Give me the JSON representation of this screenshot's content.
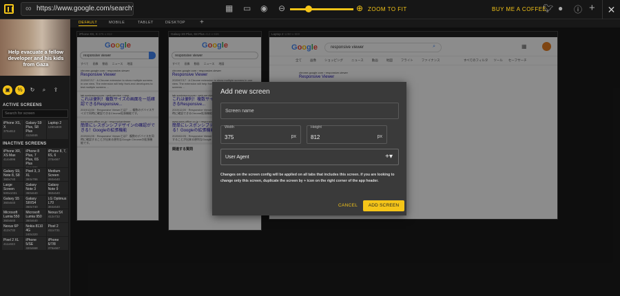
{
  "header": {
    "url": "https://www.google.com/search?q=",
    "zoom_label": "ZOOM TO FIT",
    "coffee_label": "BUY ME A COFFEE",
    "zoom_level": 0.38
  },
  "sidebar": {
    "banner_text": "Help evacuate a fellow developer and his kids from Gaza",
    "active_title": "ACTIVE SCREENS",
    "search_placeholder": "Search for screen",
    "inactive_title": "INACTIVE SCREENS",
    "active": [
      {
        "name": "iPhone XS, X",
        "dim": "375x812"
      },
      {
        "name": "Galaxy S9 Plus, S8 Plus",
        "dim": "412x846"
      },
      {
        "name": "Laptop 2",
        "dim": "1280x800"
      }
    ],
    "inactive": [
      {
        "name": "iPhone XR, XS Max",
        "dim": "414x896"
      },
      {
        "name": "iPhone 8 Plus, 7 Plus, 6S Plus",
        "dim": "414x736"
      },
      {
        "name": "iPhone 8, 7, 6S, 6",
        "dim": "375x667"
      },
      {
        "name": "Galaxy S9, Note 8, S8",
        "dim": "360x740"
      },
      {
        "name": "Pixel 3, 3 XL",
        "dim": "393x786"
      },
      {
        "name": "Medium Screen",
        "dim": "360x640"
      },
      {
        "name": "Large Screen",
        "dim": "500x1031"
      },
      {
        "name": "Galaxy Note 3",
        "dim": "360x640"
      },
      {
        "name": "Galaxy Note 9",
        "dim": "360x640"
      },
      {
        "name": "Galaxy S5",
        "dim": "360x640"
      },
      {
        "name": "Galaxy SIII/S4",
        "dim": "360x740"
      },
      {
        "name": "LG Optimus L70",
        "dim": "384x640"
      },
      {
        "name": "Microsoft Lumia 550",
        "dim": "360x640"
      },
      {
        "name": "Microsoft Lumia 950",
        "dim": "360x640"
      },
      {
        "name": "Nexus 5X",
        "dim": "412x732"
      },
      {
        "name": "Nexus 6P",
        "dim": "412x732"
      },
      {
        "name": "Nokia 8110 4G",
        "dim": "240x320"
      },
      {
        "name": "Pixel 2",
        "dim": "411x731"
      },
      {
        "name": "Pixel 2 XL",
        "dim": "411x823"
      },
      {
        "name": "iPhone 5/SE",
        "dim": "320x568"
      },
      {
        "name": "iPhone 6/7/8",
        "dim": "375x667"
      }
    ]
  },
  "device_tabs": [
    "DEFAULT",
    "MOBILE",
    "TABLET",
    "DESKTOP"
  ],
  "frames": [
    {
      "title": "iPhone XS, X",
      "dim": "375 x 812"
    },
    {
      "title": "Galaxy S9 Plus, S8 Plus",
      "dim": "412 x 846"
    },
    {
      "title": "Laptop 2",
      "dim": "1280 x 800"
    }
  ],
  "google": {
    "query": "responsive viewer",
    "nav": [
      "すべて",
      "画像",
      "動画",
      "ニュース",
      "地図"
    ],
    "r1_url": "chrome.google.com › responsive-viewer",
    "r1_title": "Responsive Viewer",
    "r1_snip": "2020/07/17 · A Chrome extension to show multiple screens in one view. The extension will help front-end developers to test multiple screens ...",
    "r2_url": "lab.sonicmoov.com › web-service › resp...",
    "r2_title": "これは便利！複数サイズの画面を一括確認できるResponsive...",
    "r2_snip": "2019/12/20 · Responsive Viewerとは？ ... 複数のデバイスサイズで同時に確認できるChrome拡張機能です。",
    "r3_url": "www.aura-office.co.jp › responsiveviewer",
    "r3_title": "簡単にレスポンシブデザインの確認ができる！Googleの拡張機能",
    "r3_snip": "2020/02/25 · Responsive Viewerとは？ 複数のデバイスを同時に確認することが出来る便利なGoogle Chromeの拡張機能です。",
    "related": "関連する質問",
    "laptop_nav": [
      "全て",
      "画像",
      "ショッピング",
      "ニュース",
      "動画",
      "地図",
      "フライト",
      "ファイナンス"
    ],
    "laptop_tools": [
      "すべてのフィルタ",
      "ツール",
      "セーフサーチ"
    ]
  },
  "modal": {
    "title": "Add new screen",
    "name_placeholder": "Screen name",
    "width_label": "Width",
    "width_value": "375",
    "height_label": "Height",
    "height_value": "812",
    "unit": "px",
    "ua_label": "User Agent",
    "note": "Changes on the screen config will be applied on all tabs that includes this screen. if you are looking to change only this screen, duplicate the screen by + icon on the right corner of the app header.",
    "cancel": "CANCEL",
    "add": "ADD SCREEN"
  },
  "colors": {
    "accent": "#f5c518",
    "bg": "#1b1b1b",
    "modal": "#3a3a3a"
  }
}
